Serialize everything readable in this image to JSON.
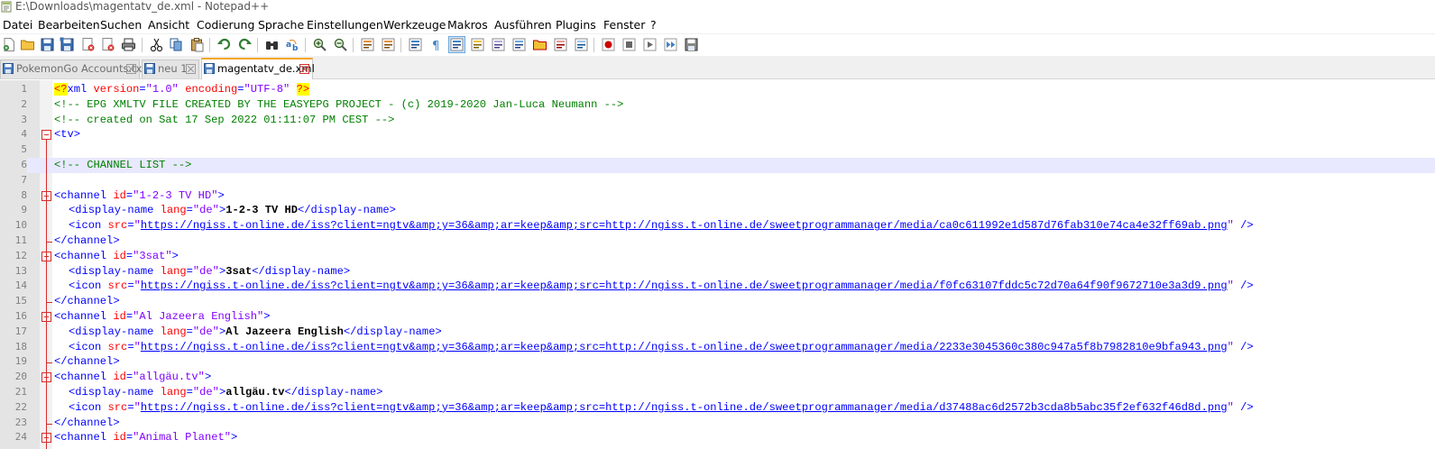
{
  "window": {
    "title": "E:\\Downloads\\magentatv_de.xml - Notepad++"
  },
  "menu": [
    "Datei",
    "Bearbeiten",
    "Suchen",
    "Ansicht",
    "Codierung",
    "Sprache",
    "Einstellungen",
    "Werkzeuge",
    "Makros",
    "Ausführen",
    "Plugins",
    "Fenster",
    "?"
  ],
  "toolbar": {
    "icons": [
      "new-file-icon",
      "open-file-icon",
      "save-icon",
      "save-all-icon",
      "close-icon",
      "close-all-icon",
      "print-icon",
      "cut-icon",
      "copy-icon",
      "paste-icon",
      "undo-icon",
      "redo-icon",
      "find-icon",
      "replace-icon",
      "zoom-in-icon",
      "zoom-out-icon",
      "sync-vertical-icon",
      "sync-horizontal-icon",
      "word-wrap-icon",
      "show-all-characters-icon",
      "indent-guide-icon",
      "user-defined-language-icon",
      "document-map-icon",
      "function-list-icon",
      "folder-as-workspace-icon",
      "document-list-icon",
      "monitoring-icon",
      "record-macro-icon",
      "stop-recording-icon",
      "playback-macro-icon",
      "run-macro-multiple-icon",
      "save-macro-icon"
    ]
  },
  "tabs": [
    {
      "label": "PokemonGo Accounts.txt",
      "active": false
    },
    {
      "label": "neu 1",
      "active": false
    },
    {
      "label": "magentatv_de.xml",
      "active": true
    }
  ],
  "editor": {
    "current_line": 6,
    "lines": [
      {
        "n": "1",
        "indent": 0,
        "segments": [
          [
            "pi",
            "<?"
          ],
          [
            "tag",
            "xml "
          ],
          [
            "attr",
            "version"
          ],
          [
            "tag",
            "="
          ],
          [
            "val",
            "\"1.0\""
          ],
          [
            "tag",
            " "
          ],
          [
            "attr",
            "encoding"
          ],
          [
            "tag",
            "="
          ],
          [
            "val",
            "\"UTF-8\""
          ],
          [
            "tag",
            " "
          ],
          [
            "pi",
            "?>"
          ]
        ]
      },
      {
        "n": "2",
        "indent": 0,
        "segments": [
          [
            "comment",
            "<!-- EPG XMLTV FILE CREATED BY THE EASYEPG PROJECT - (c) 2019-2020 Jan-Luca Neumann -->"
          ]
        ]
      },
      {
        "n": "3",
        "indent": 0,
        "segments": [
          [
            "comment",
            "<!-- created on Sat 17 Sep 2022 01:11:07 PM CEST -->"
          ]
        ]
      },
      {
        "n": "4",
        "indent": 0,
        "fold": true,
        "segments": [
          [
            "tag",
            "<tv>"
          ]
        ]
      },
      {
        "n": "5",
        "indent": 0,
        "segments": []
      },
      {
        "n": "6",
        "indent": 0,
        "segments": [
          [
            "comment",
            "<!-- CHANNEL LIST -->"
          ]
        ]
      },
      {
        "n": "7",
        "indent": 0,
        "segments": []
      },
      {
        "n": "8",
        "indent": 0,
        "fold": true,
        "segments": [
          [
            "tag",
            "<channel "
          ],
          [
            "attr",
            "id"
          ],
          [
            "tag",
            "="
          ],
          [
            "val",
            "\"1-2-3 TV HD\""
          ],
          [
            "tag",
            ">"
          ]
        ]
      },
      {
        "n": "9",
        "indent": 1,
        "segments": [
          [
            "tag",
            "<display-name "
          ],
          [
            "attr",
            "lang"
          ],
          [
            "tag",
            "="
          ],
          [
            "val",
            "\"de\""
          ],
          [
            "tag",
            ">"
          ],
          [
            "text",
            "1-2-3 TV HD"
          ],
          [
            "tag",
            "</display-name>"
          ]
        ]
      },
      {
        "n": "10",
        "indent": 1,
        "segments": [
          [
            "tag",
            "<icon "
          ],
          [
            "attr",
            "src"
          ],
          [
            "tag",
            "="
          ],
          [
            "val",
            "\""
          ],
          [
            "url",
            "https://ngiss.t-online.de/iss?client=ngtv&amp;y=36&amp;ar=keep&amp;src=http://ngiss.t-online.de/sweetprogrammanager/media/ca0c611992e1d587d76fab310e74ca4e32ff69ab.png"
          ],
          [
            "val",
            "\""
          ],
          [
            "tag",
            " />"
          ]
        ]
      },
      {
        "n": "11",
        "indent": 0,
        "foldend": true,
        "segments": [
          [
            "tag",
            "</channel>"
          ]
        ]
      },
      {
        "n": "12",
        "indent": 0,
        "fold": true,
        "segments": [
          [
            "tag",
            "<channel "
          ],
          [
            "attr",
            "id"
          ],
          [
            "tag",
            "="
          ],
          [
            "val",
            "\"3sat\""
          ],
          [
            "tag",
            ">"
          ]
        ]
      },
      {
        "n": "13",
        "indent": 1,
        "segments": [
          [
            "tag",
            "<display-name "
          ],
          [
            "attr",
            "lang"
          ],
          [
            "tag",
            "="
          ],
          [
            "val",
            "\"de\""
          ],
          [
            "tag",
            ">"
          ],
          [
            "text",
            "3sat"
          ],
          [
            "tag",
            "</display-name>"
          ]
        ]
      },
      {
        "n": "14",
        "indent": 1,
        "segments": [
          [
            "tag",
            "<icon "
          ],
          [
            "attr",
            "src"
          ],
          [
            "tag",
            "="
          ],
          [
            "val",
            "\""
          ],
          [
            "url",
            "https://ngiss.t-online.de/iss?client=ngtv&amp;y=36&amp;ar=keep&amp;src=http://ngiss.t-online.de/sweetprogrammanager/media/f0fc63107fddc5c72d70a64f90f9672710e3a3d9.png"
          ],
          [
            "val",
            "\""
          ],
          [
            "tag",
            " />"
          ]
        ]
      },
      {
        "n": "15",
        "indent": 0,
        "foldend": true,
        "segments": [
          [
            "tag",
            "</channel>"
          ]
        ]
      },
      {
        "n": "16",
        "indent": 0,
        "fold": true,
        "segments": [
          [
            "tag",
            "<channel "
          ],
          [
            "attr",
            "id"
          ],
          [
            "tag",
            "="
          ],
          [
            "val",
            "\"Al Jazeera English\""
          ],
          [
            "tag",
            ">"
          ]
        ]
      },
      {
        "n": "17",
        "indent": 1,
        "segments": [
          [
            "tag",
            "<display-name "
          ],
          [
            "attr",
            "lang"
          ],
          [
            "tag",
            "="
          ],
          [
            "val",
            "\"de\""
          ],
          [
            "tag",
            ">"
          ],
          [
            "text",
            "Al Jazeera English"
          ],
          [
            "tag",
            "</display-name>"
          ]
        ]
      },
      {
        "n": "18",
        "indent": 1,
        "segments": [
          [
            "tag",
            "<icon "
          ],
          [
            "attr",
            "src"
          ],
          [
            "tag",
            "="
          ],
          [
            "val",
            "\""
          ],
          [
            "url",
            "https://ngiss.t-online.de/iss?client=ngtv&amp;y=36&amp;ar=keep&amp;src=http://ngiss.t-online.de/sweetprogrammanager/media/2233e3045360c380c947a5f8b7982810e9bfa943.png"
          ],
          [
            "val",
            "\""
          ],
          [
            "tag",
            " />"
          ]
        ]
      },
      {
        "n": "19",
        "indent": 0,
        "foldend": true,
        "segments": [
          [
            "tag",
            "</channel>"
          ]
        ]
      },
      {
        "n": "20",
        "indent": 0,
        "fold": true,
        "segments": [
          [
            "tag",
            "<channel "
          ],
          [
            "attr",
            "id"
          ],
          [
            "tag",
            "="
          ],
          [
            "val",
            "\"allgäu.tv\""
          ],
          [
            "tag",
            ">"
          ]
        ]
      },
      {
        "n": "21",
        "indent": 1,
        "segments": [
          [
            "tag",
            "<display-name "
          ],
          [
            "attr",
            "lang"
          ],
          [
            "tag",
            "="
          ],
          [
            "val",
            "\"de\""
          ],
          [
            "tag",
            ">"
          ],
          [
            "text",
            "allgäu.tv"
          ],
          [
            "tag",
            "</display-name>"
          ]
        ]
      },
      {
        "n": "22",
        "indent": 1,
        "segments": [
          [
            "tag",
            "<icon "
          ],
          [
            "attr",
            "src"
          ],
          [
            "tag",
            "="
          ],
          [
            "val",
            "\""
          ],
          [
            "url",
            "https://ngiss.t-online.de/iss?client=ngtv&amp;y=36&amp;ar=keep&amp;src=http://ngiss.t-online.de/sweetprogrammanager/media/d37488ac6d2572b3cda8b5abc35f2ef632f46d8d.png"
          ],
          [
            "val",
            "\""
          ],
          [
            "tag",
            " />"
          ]
        ]
      },
      {
        "n": "23",
        "indent": 0,
        "foldend": true,
        "segments": [
          [
            "tag",
            "</channel>"
          ]
        ]
      },
      {
        "n": "24",
        "indent": 0,
        "fold": true,
        "segments": [
          [
            "tag",
            "<channel "
          ],
          [
            "attr",
            "id"
          ],
          [
            "tag",
            "="
          ],
          [
            "val",
            "\"Animal Planet\""
          ],
          [
            "tag",
            ">"
          ]
        ]
      }
    ]
  }
}
